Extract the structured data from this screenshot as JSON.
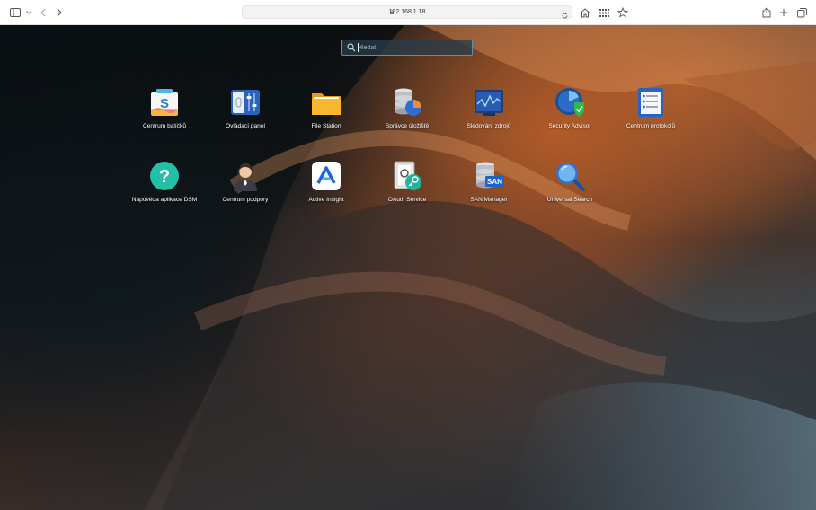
{
  "browser": {
    "url": "192.168.1.18"
  },
  "search": {
    "placeholder": "Hledat"
  },
  "apps": [
    {
      "label": "Centrum balíčků",
      "icon": "package-center-icon"
    },
    {
      "label": "Ovládací panel",
      "icon": "control-panel-icon"
    },
    {
      "label": "File Station",
      "icon": "folder-icon"
    },
    {
      "label": "Správce úložiště",
      "icon": "storage-manager-icon"
    },
    {
      "label": "Sledování zdrojů",
      "icon": "resource-monitor-icon"
    },
    {
      "label": "Security Advisor",
      "icon": "security-advisor-icon"
    },
    {
      "label": "Centrum protokolů",
      "icon": "log-center-icon"
    },
    {
      "label": "Nápověda aplikace DSM",
      "icon": "help-icon"
    },
    {
      "label": "Centrum podpory",
      "icon": "support-agent-icon"
    },
    {
      "label": "Active Insight",
      "icon": "active-insight-icon"
    },
    {
      "label": "OAuth Service",
      "icon": "oauth-service-icon"
    },
    {
      "label": "SAN Manager",
      "icon": "san-manager-icon"
    },
    {
      "label": "Universal Search",
      "icon": "universal-search-icon"
    }
  ]
}
